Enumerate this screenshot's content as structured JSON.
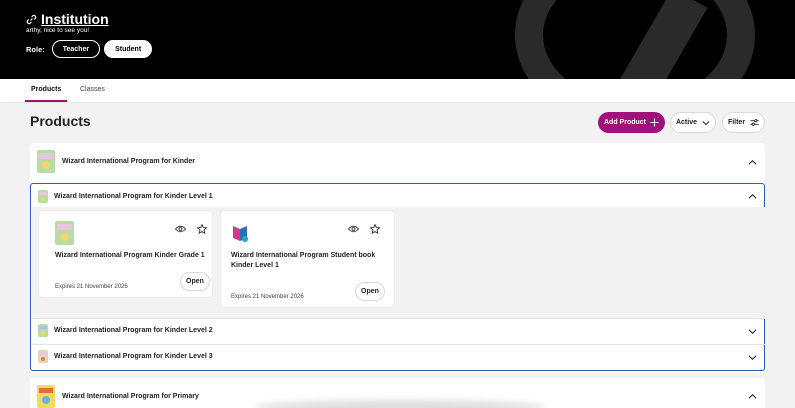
{
  "header": {
    "title": "Institution",
    "greeting": "arthy, nice to see you!",
    "role_label": "Role:",
    "roles": [
      {
        "label": "Teacher",
        "selected": false
      },
      {
        "label": "Student",
        "selected": true
      }
    ]
  },
  "tabs": [
    {
      "label": "Products",
      "active": true
    },
    {
      "label": "Classes",
      "active": false
    }
  ],
  "main": {
    "heading": "Products",
    "add_product_label": "Add Product",
    "status_filter_value": "Active",
    "filter_label": "Filter"
  },
  "program_kinder": {
    "title": "Wizard International Program for Kinder",
    "expanded": true,
    "levels": [
      {
        "title": "Wizard International Program for Kinder Level 1",
        "expanded": true,
        "products": [
          {
            "name": "Wizard International Program Kinder Grade 1",
            "expires": "Expires 21 November 2026",
            "open_label": "Open"
          },
          {
            "name": "Wizard International Program Student book Kinder Level 1",
            "expires": "Expires 21 November 2026",
            "open_label": "Open"
          }
        ]
      },
      {
        "title": "Wizard International Program for Kinder Level 2",
        "expanded": false
      },
      {
        "title": "Wizard International Program for Kinder Level 3",
        "expanded": false
      }
    ]
  },
  "program_primary": {
    "title": "Wizard International Program for Primary",
    "expanded": true
  },
  "colors": {
    "accent": "#a0127a",
    "focus_border": "#2d5db6",
    "header_bg": "#000000",
    "page_bg": "#f2f2f2"
  },
  "icons": [
    "link-icon",
    "plus-icon",
    "chevron-down-icon",
    "filter-sliders-icon",
    "chevron-up-icon",
    "eye-icon",
    "star-icon",
    "book-thumbnail-icon"
  ]
}
